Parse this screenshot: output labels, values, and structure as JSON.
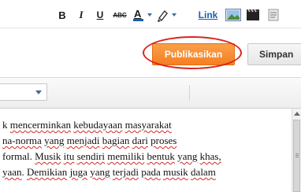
{
  "header": {
    "publish_label": "Publikasikan",
    "save_label": "Simpan"
  },
  "toolbar": {
    "bold": "B",
    "italic": "I",
    "underline": "U",
    "strikethrough": "ABC",
    "text_color": "A",
    "link_label": "Link"
  },
  "editor": {
    "lines": [
      {
        "segments": [
          {
            "text": "k ",
            "squiggle": false
          },
          {
            "text": "mencerminkan",
            "squiggle": true
          },
          {
            "text": " ",
            "squiggle": false
          },
          {
            "text": "kebudayaan",
            "squiggle": true
          },
          {
            "text": " ",
            "squiggle": false
          },
          {
            "text": "masyarakat",
            "squiggle": true
          }
        ]
      },
      {
        "segments": [
          {
            "text": "na-norma",
            "squiggle": true
          },
          {
            "text": " ",
            "squiggle": false
          },
          {
            "text": "yang",
            "squiggle": true
          },
          {
            "text": " ",
            "squiggle": false
          },
          {
            "text": "menjadi",
            "squiggle": true
          },
          {
            "text": " ",
            "squiggle": false
          },
          {
            "text": "bagian",
            "squiggle": true
          },
          {
            "text": " ",
            "squiggle": false
          },
          {
            "text": "dari",
            "squiggle": true
          },
          {
            "text": " ",
            "squiggle": false
          },
          {
            "text": "proses",
            "squiggle": true
          }
        ]
      },
      {
        "segments": [
          {
            "text": "formal. ",
            "squiggle": false
          },
          {
            "text": "Musik",
            "squiggle": true
          },
          {
            "text": " ",
            "squiggle": false
          },
          {
            "text": "itu",
            "squiggle": true
          },
          {
            "text": " ",
            "squiggle": false
          },
          {
            "text": "sendiri",
            "squiggle": true
          },
          {
            "text": " ",
            "squiggle": false
          },
          {
            "text": "memiliki",
            "squiggle": true
          },
          {
            "text": " ",
            "squiggle": false
          },
          {
            "text": "bentuk",
            "squiggle": true
          },
          {
            "text": " ",
            "squiggle": false
          },
          {
            "text": "yang",
            "squiggle": true
          },
          {
            "text": " ",
            "squiggle": false
          },
          {
            "text": "khas,",
            "squiggle": true
          }
        ]
      },
      {
        "segments": [
          {
            "text": "yaan",
            "squiggle": true
          },
          {
            "text": ". ",
            "squiggle": false
          },
          {
            "text": "Demikian",
            "squiggle": true
          },
          {
            "text": " ",
            "squiggle": false
          },
          {
            "text": "juga",
            "squiggle": true
          },
          {
            "text": " ",
            "squiggle": false
          },
          {
            "text": "yang",
            "squiggle": true
          },
          {
            "text": " ",
            "squiggle": false
          },
          {
            "text": "terjadi",
            "squiggle": true
          },
          {
            "text": " ",
            "squiggle": false
          },
          {
            "text": "pada",
            "squiggle": true
          },
          {
            "text": " ",
            "squiggle": false
          },
          {
            "text": "musik",
            "squiggle": true
          },
          {
            "text": " ",
            "squiggle": false
          },
          {
            "text": "dalam",
            "squiggle": true
          }
        ]
      }
    ]
  },
  "colors": {
    "publish_button": "#f57f21",
    "highlight_ring": "#d9261c",
    "link": "#1a5fb4",
    "spellcheck": "#d02a2a"
  },
  "icons": [
    "chevron-down-icon",
    "text-color-icon",
    "highlight-color-icon",
    "image-icon",
    "video-icon"
  ]
}
